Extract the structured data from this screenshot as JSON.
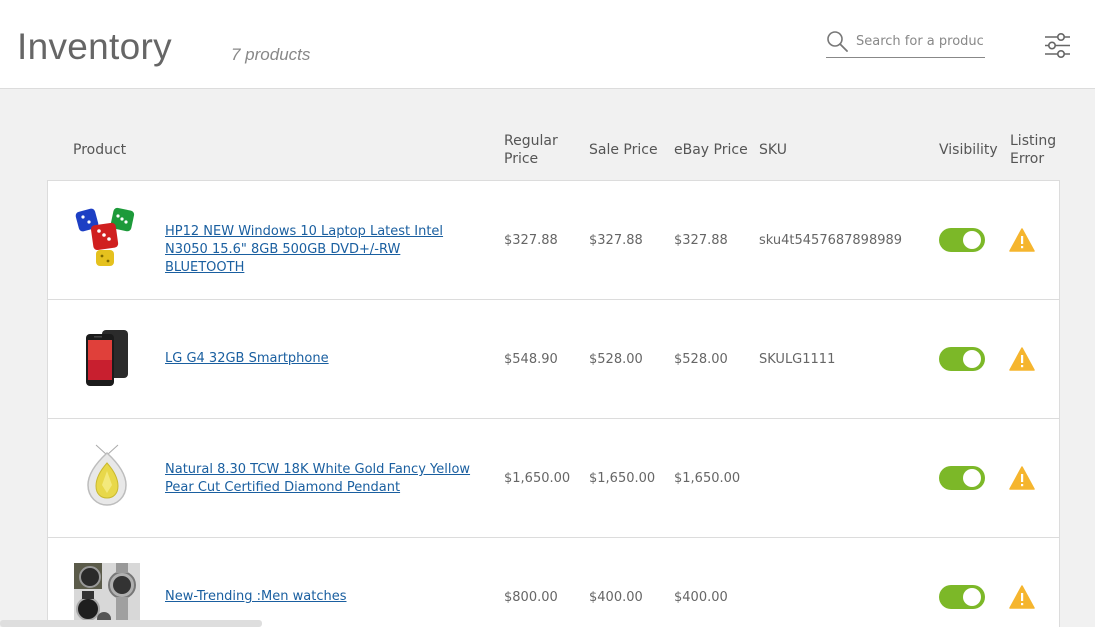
{
  "header": {
    "title": "Inventory",
    "product_count": "7 products",
    "search": {
      "placeholder": "Search for a product",
      "value": ""
    }
  },
  "icons": {
    "search": "search-icon",
    "filter": "sliders-icon",
    "warning": "warning-triangle-icon"
  },
  "colors": {
    "toggle_on": "#7cb828",
    "warning": "#f5b52e",
    "link": "#1a5fa0"
  },
  "columns": {
    "product": "Product",
    "regular_price": "Regular\nPrice",
    "sale_price": "Sale Price",
    "ebay_price": "eBay Price",
    "sku": "SKU",
    "visibility": "Visibility",
    "listing_error": "Listing\nError"
  },
  "products": [
    {
      "name": "HP12 NEW Windows 10 Laptop Latest Intel N3050 15.6\" 8GB 500GB DVD+/-RW BLUETOOTH",
      "regular_price": "$327.88",
      "sale_price": "$327.88",
      "ebay_price": "$327.88",
      "sku": "sku4t5457687898989",
      "visible": true,
      "listing_error": true,
      "thumb": "dice"
    },
    {
      "name": "LG G4 32GB Smartphone",
      "regular_price": "$548.90",
      "sale_price": "$528.00",
      "ebay_price": "$528.00",
      "sku": "SKULG1111",
      "visible": true,
      "listing_error": true,
      "thumb": "phone"
    },
    {
      "name": "Natural 8.30 TCW 18K White Gold Fancy Yellow Pear Cut Certified Diamond Pendant",
      "regular_price": "$1,650.00",
      "sale_price": "$1,650.00",
      "ebay_price": "$1,650.00",
      "sku": "",
      "visible": true,
      "listing_error": true,
      "thumb": "pendant"
    },
    {
      "name": "New-Trending :Men watches",
      "regular_price": "$800.00",
      "sale_price": "$400.00",
      "ebay_price": "$400.00",
      "sku": "",
      "visible": true,
      "listing_error": true,
      "thumb": "watches"
    }
  ]
}
